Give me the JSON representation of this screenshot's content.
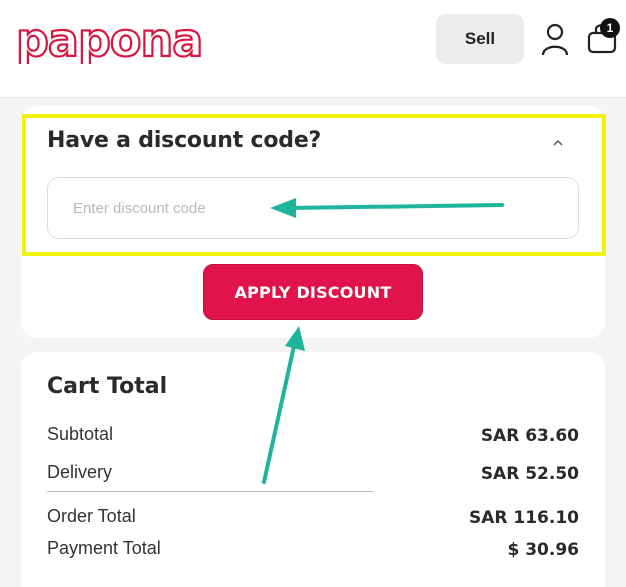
{
  "header": {
    "logo_text": "papona",
    "sell_label": "Sell",
    "cart_count": "1",
    "icons": {
      "user": "user-icon",
      "bag": "shopping-bag-icon"
    }
  },
  "discount": {
    "title": "Have a discount code?",
    "toggle_icon": "chevron-up-icon",
    "input_placeholder": "Enter discount code",
    "input_value": "",
    "apply_label": "APPLY DISCOUNT"
  },
  "cart": {
    "title": "Cart Total",
    "rows": [
      {
        "label": "Subtotal",
        "value": "SAR 63.60"
      },
      {
        "label": "Delivery",
        "value": "SAR 52.50"
      },
      {
        "label": "Order Total",
        "value": "SAR 116.10"
      },
      {
        "label": "Payment Total",
        "value": "$ 30.96"
      }
    ]
  },
  "colors": {
    "brand": "#e0144a",
    "highlight": "#f5f10f",
    "annotation_arrow": "#1fb59c",
    "page_bg": "#f4f4f5"
  }
}
